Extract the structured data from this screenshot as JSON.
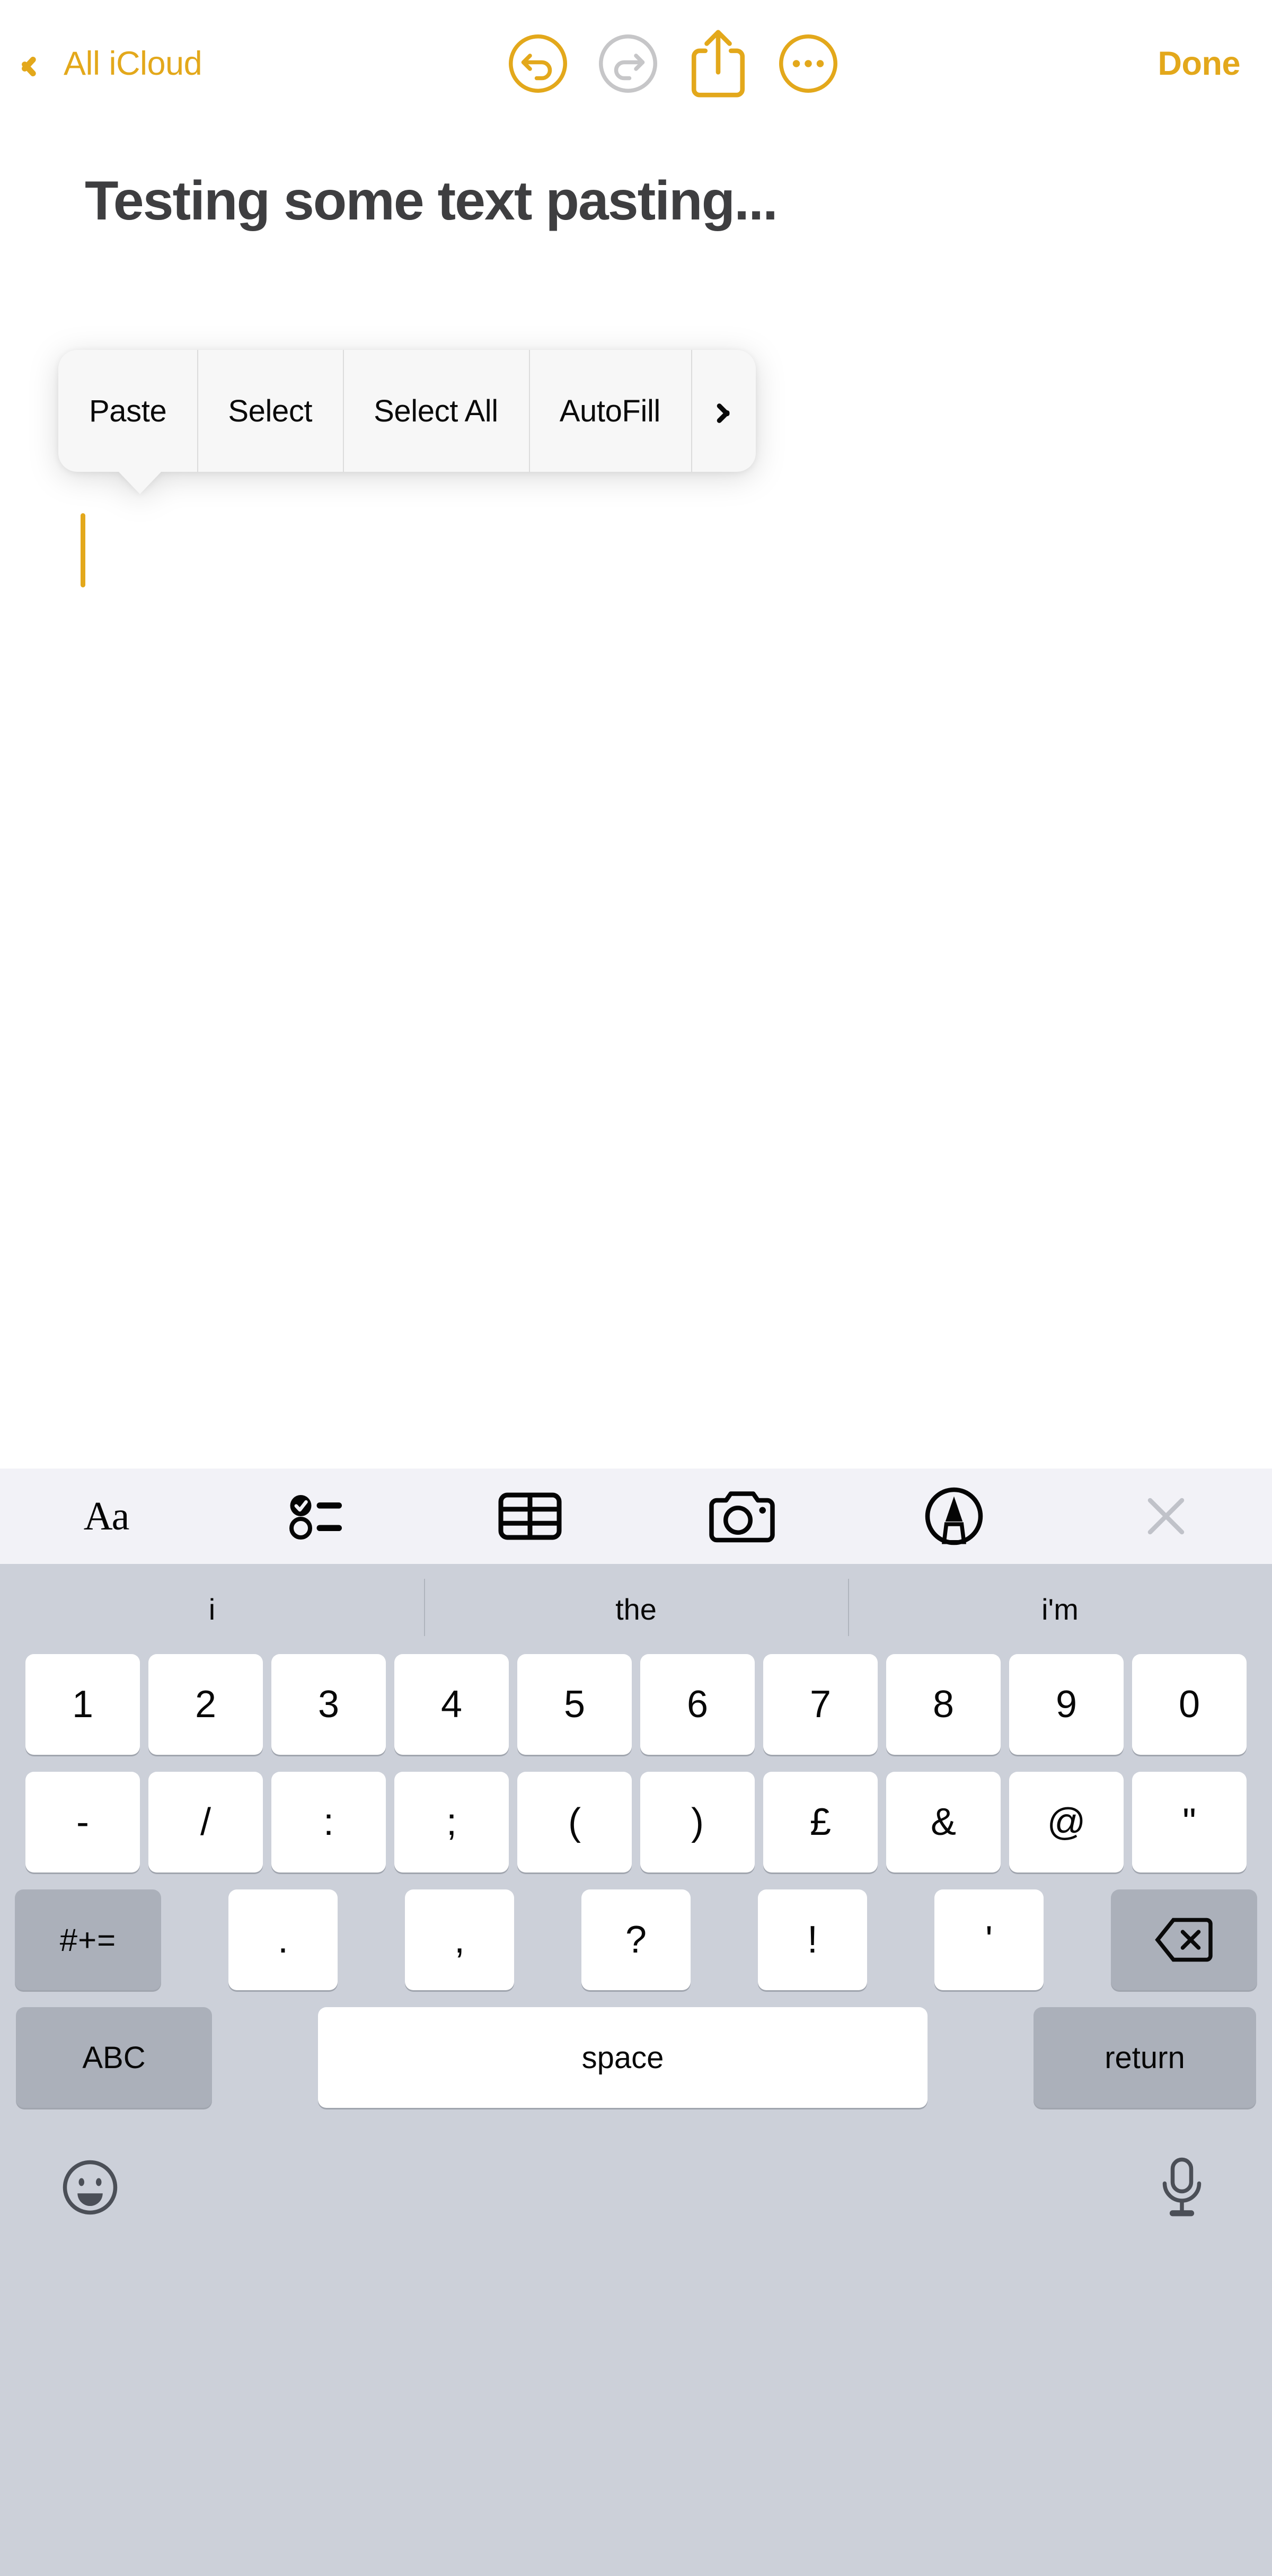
{
  "app": "Apple Notes",
  "colors": {
    "accent": "#E3A81B",
    "disabled": "#C6C6C8",
    "title_text": "#3E3E40",
    "toolbar_bg": "#F2F2F7",
    "keyboard_bg": "#CCD0D9",
    "key_white": "#FFFFFF",
    "key_gray": "#ABB0BA",
    "menu_bg": "#F7F7F7"
  },
  "navbar": {
    "back_label": "All iCloud",
    "back_icon": "chevron-left-icon",
    "actions": [
      {
        "name": "undo-button",
        "icon": "undo-circle-icon",
        "enabled": true
      },
      {
        "name": "redo-button",
        "icon": "redo-circle-icon",
        "enabled": false
      },
      {
        "name": "share-button",
        "icon": "share-icon",
        "enabled": true
      },
      {
        "name": "more-button",
        "icon": "ellipsis-circle-icon",
        "enabled": true
      }
    ],
    "done_label": "Done"
  },
  "note": {
    "title": "Testing some text pasting...",
    "body_text": "",
    "caret_visible": true
  },
  "context_menu": {
    "items": [
      {
        "label": "Paste"
      },
      {
        "label": "Select"
      },
      {
        "label": "Select All"
      },
      {
        "label": "AutoFill"
      }
    ],
    "more_icon": "chevron-right-icon"
  },
  "notes_toolbar": {
    "items": [
      {
        "name": "format-button",
        "label": "Aa",
        "icon": "text-format-icon"
      },
      {
        "name": "checklist-button",
        "label": "",
        "icon": "checklist-icon"
      },
      {
        "name": "table-button",
        "label": "",
        "icon": "table-icon"
      },
      {
        "name": "camera-button",
        "label": "",
        "icon": "camera-icon"
      },
      {
        "name": "markup-button",
        "label": "",
        "icon": "markup-pen-icon"
      },
      {
        "name": "close-keyboard-button",
        "label": "",
        "icon": "close-x-icon",
        "enabled": false
      }
    ]
  },
  "keyboard": {
    "layout": "numeric-symbols",
    "predictive": [
      "i",
      "the",
      "i'm"
    ],
    "row1": [
      "1",
      "2",
      "3",
      "4",
      "5",
      "6",
      "7",
      "8",
      "9",
      "0"
    ],
    "row2": [
      "-",
      "/",
      ":",
      ";",
      "(",
      ")",
      "£",
      "&",
      "@",
      "\""
    ],
    "row3": {
      "symbols_key": "#+=",
      "keys": [
        ".",
        ",",
        "?",
        "!",
        "'"
      ],
      "delete_icon": "backspace-icon"
    },
    "row4": {
      "abc_key": "ABC",
      "space_key": "space",
      "return_key": "return"
    },
    "bottom": {
      "emoji_icon": "emoji-smiley-icon",
      "dictation_icon": "microphone-icon"
    }
  }
}
